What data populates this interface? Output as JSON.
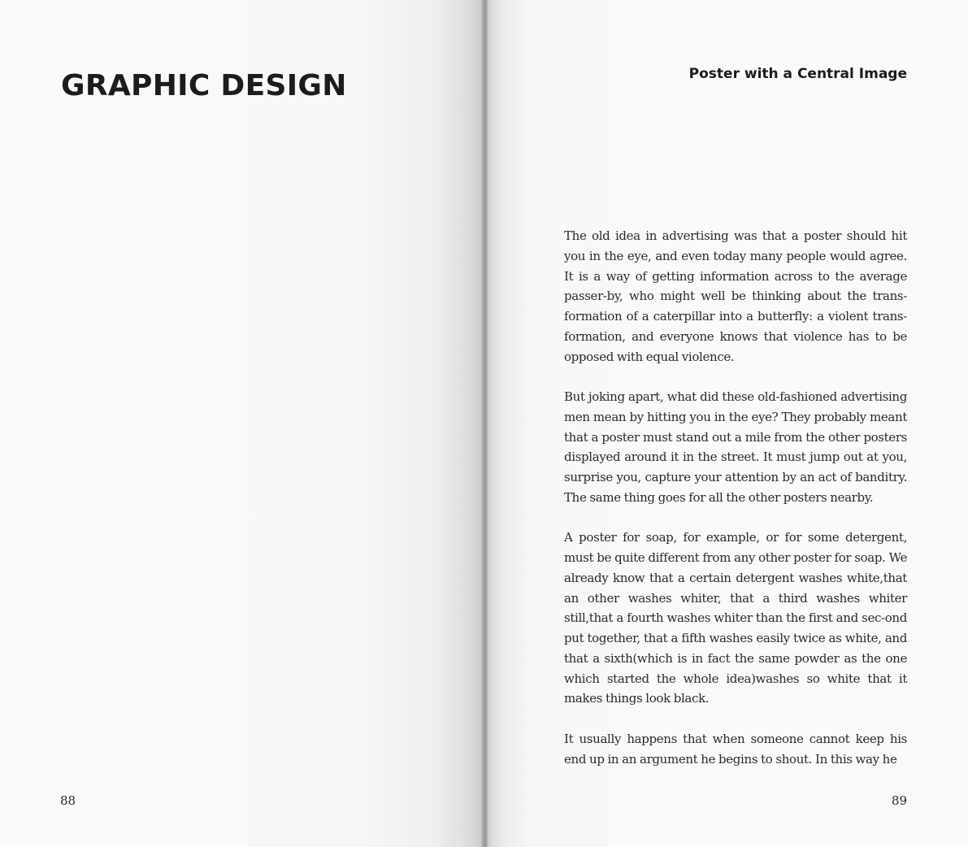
{
  "left_page": {
    "section_title": "GRAPHIC DESIGN",
    "page_number": "88"
  },
  "right_page": {
    "chapter_title": "Poster with a Central Image",
    "paragraphs": [
      "The old idea in advertising was that a poster should hit you in the eye, and even today many people would agree. It is a way of getting information across to the average passer-by, who might well be thinking about the trans-formation of a caterpillar into a butterfly: a violent trans-formation, and everyone knows that violence has to be opposed with equal violence.",
      "But joking apart, what did these old-fashioned advertising men mean by hitting you in the eye? They probably meant that a poster must stand out a mile from the other posters displayed around it in the street. It must jump out at you, surprise you, capture your attention by an act of banditry. The same thing goes for all the other posters nearby.",
      "A poster for soap, for example, or for some detergent, must be quite different from any other poster for soap. We already know that a certain detergent washes white,that an other washes whiter, that a third washes whiter still,that a fourth washes whiter than the first and sec-ond put together, that a fifth washes easily twice as white, and that a sixth(which is in fact the same powder as the one which started the whole idea)washes so white that it makes things look black.",
      "It usually happens that when someone cannot keep his end up in an argument he begins to shout. In this way he"
    ],
    "page_number": "89"
  }
}
